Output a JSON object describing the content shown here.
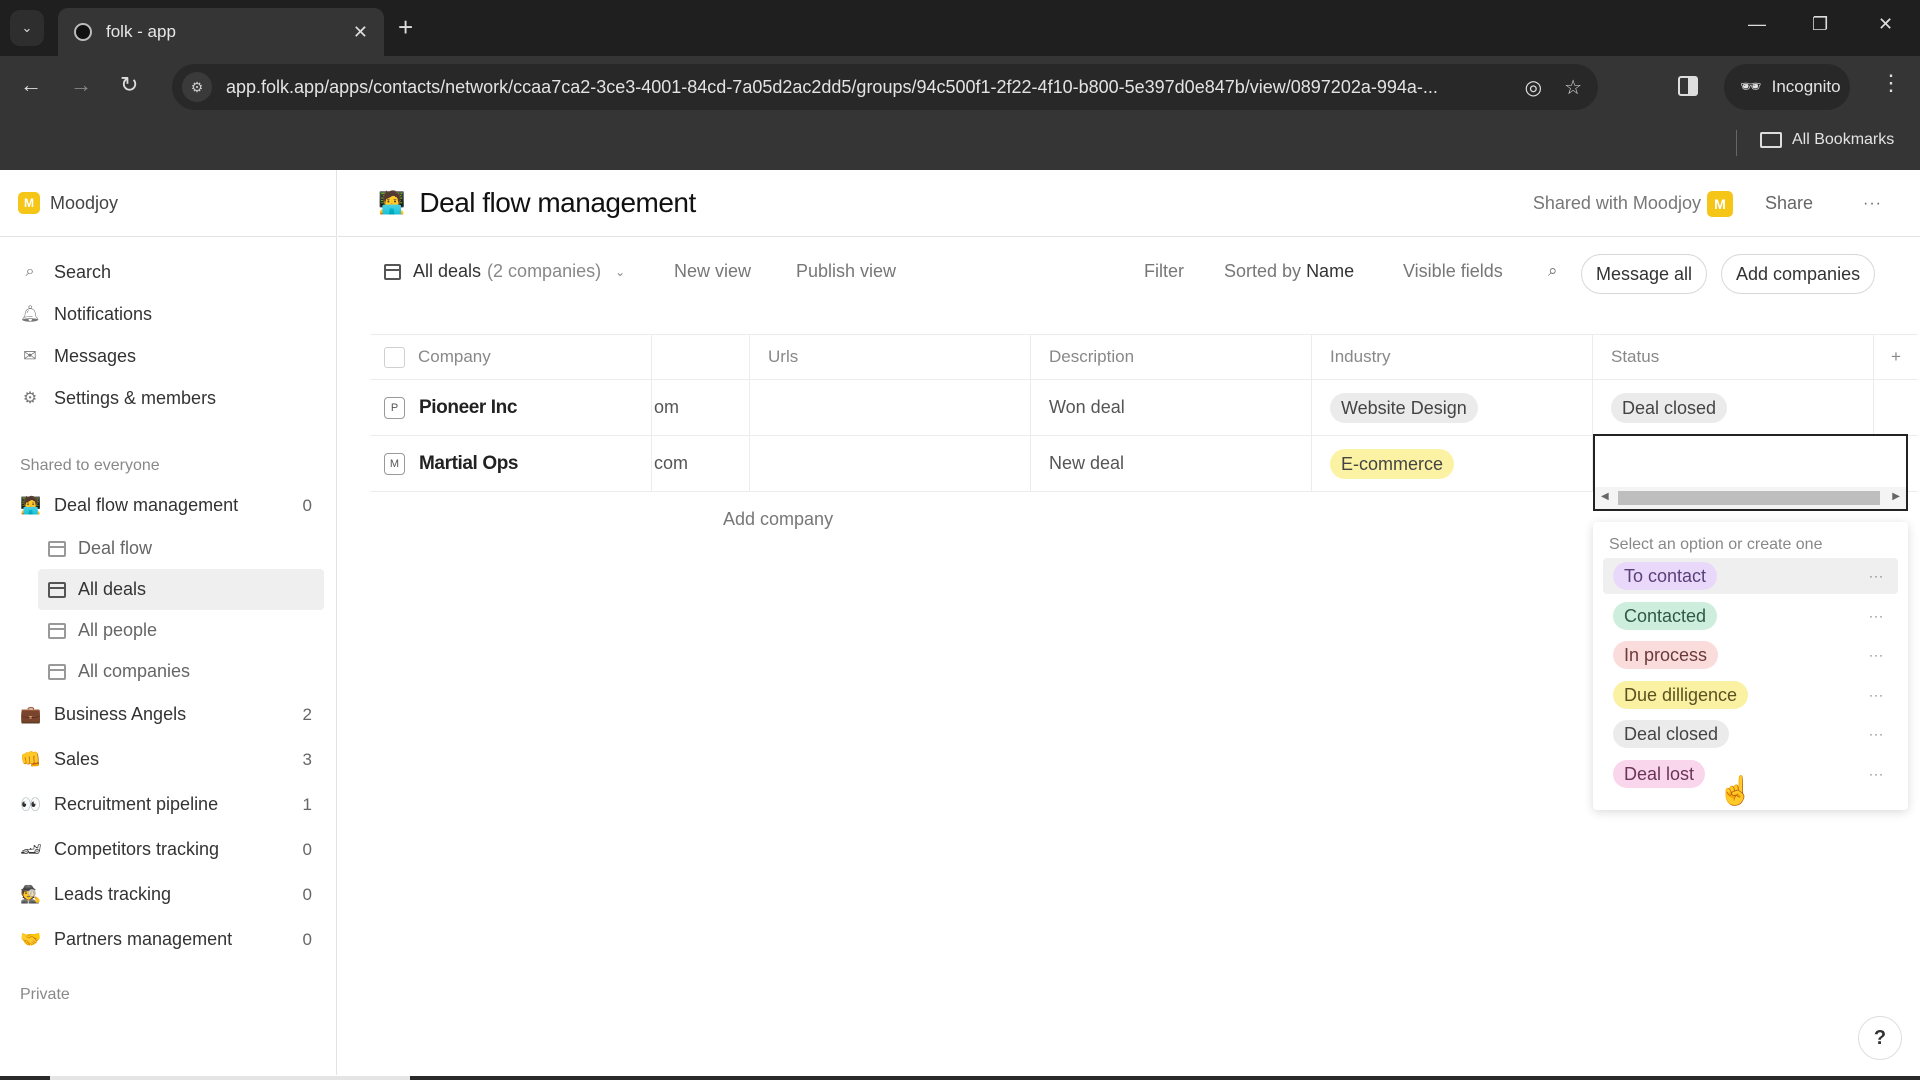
{
  "browser": {
    "tab_title": "folk - app",
    "url": "app.folk.app/apps/contacts/network/ccaa7ca2-3ce3-4001-84cd-7a05d2ac2dd5/groups/94c500f1-2f22-4f10-b800-5e397d0e847b/view/0897202a-994a-...",
    "incognito_label": "Incognito",
    "all_bookmarks_label": "All Bookmarks"
  },
  "workspace": {
    "name": "Moodjoy",
    "logo_letter": "M"
  },
  "sidebar": {
    "nav": [
      {
        "label": "Search",
        "icon": "search-icon"
      },
      {
        "label": "Notifications",
        "icon": "bell-icon"
      },
      {
        "label": "Messages",
        "icon": "mail-icon"
      },
      {
        "label": "Settings & members",
        "icon": "gear-icon"
      }
    ],
    "shared_label": "Shared to everyone",
    "groups": [
      {
        "emoji": "🧑‍💻",
        "label": "Deal flow management",
        "count": "0",
        "views": [
          {
            "label": "Deal flow",
            "icon": "kanban-icon",
            "active": false
          },
          {
            "label": "All deals",
            "icon": "table-icon",
            "active": true
          },
          {
            "label": "All people",
            "icon": "table-icon",
            "active": false
          },
          {
            "label": "All companies",
            "icon": "table-icon",
            "active": false
          }
        ]
      },
      {
        "emoji": "💼",
        "label": "Business Angels",
        "count": "2"
      },
      {
        "emoji": "👊",
        "label": "Sales",
        "count": "3"
      },
      {
        "emoji": "👀",
        "label": "Recruitment pipeline",
        "count": "1"
      },
      {
        "emoji": "🏎",
        "label": "Competitors tracking",
        "count": "0"
      },
      {
        "emoji": "🕵",
        "label": "Leads tracking",
        "count": "0"
      },
      {
        "emoji": "🤝",
        "label": "Partners management",
        "count": "0"
      }
    ],
    "private_label": "Private"
  },
  "header": {
    "emoji": "🧑‍💻",
    "title": "Deal flow management",
    "shared_with": "Shared with Moodjoy",
    "shared_avatar": "M",
    "share_label": "Share",
    "more_label": "···"
  },
  "toolbar": {
    "view_name": "All deals",
    "view_count": "(2 companies)",
    "new_view": "New view",
    "publish_view": "Publish view",
    "filter": "Filter",
    "sorted_by_prefix": "Sorted by",
    "sorted_by_field": "Name",
    "visible_fields": "Visible fields",
    "message_all": "Message all",
    "add_companies": "Add companies"
  },
  "table": {
    "columns": [
      "Company",
      "",
      "Urls",
      "Description",
      "Industry",
      "Status"
    ],
    "add_column": "+",
    "rows": [
      {
        "initial": "P",
        "company": "Pioneer Inc",
        "domain": "om",
        "urls": "",
        "description": "Won deal",
        "industry": "Website Design",
        "industry_color": "#ebebeb",
        "status": "Deal closed",
        "status_color": "#ebebeb"
      },
      {
        "initial": "M",
        "company": "Martial Ops",
        "domain": "com",
        "urls": "",
        "description": "New deal",
        "industry": "E-commerce",
        "industry_color": "#fbf3a3",
        "status": "",
        "status_color": ""
      }
    ],
    "add_company": "Add company"
  },
  "status_dropdown": {
    "hint": "Select an option or create one",
    "options": [
      {
        "label": "To contact",
        "color": "#ead8fb",
        "text_color": "#5b3f77",
        "hover": true
      },
      {
        "label": "Contacted",
        "color": "#cdeedd",
        "text_color": "#2f5a45",
        "hover": false
      },
      {
        "label": "In process",
        "color": "#fbdcdc",
        "text_color": "#6b3a3a",
        "hover": false
      },
      {
        "label": "Due dilligence",
        "color": "#fbf1a3",
        "text_color": "#5a5220",
        "hover": false
      },
      {
        "label": "Deal closed",
        "color": "#ebebeb",
        "text_color": "#444444",
        "hover": false
      },
      {
        "label": "Deal lost",
        "color": "#fad6ec",
        "text_color": "#6b3458",
        "hover": false
      }
    ],
    "option_more": "···"
  },
  "help_label": "?"
}
